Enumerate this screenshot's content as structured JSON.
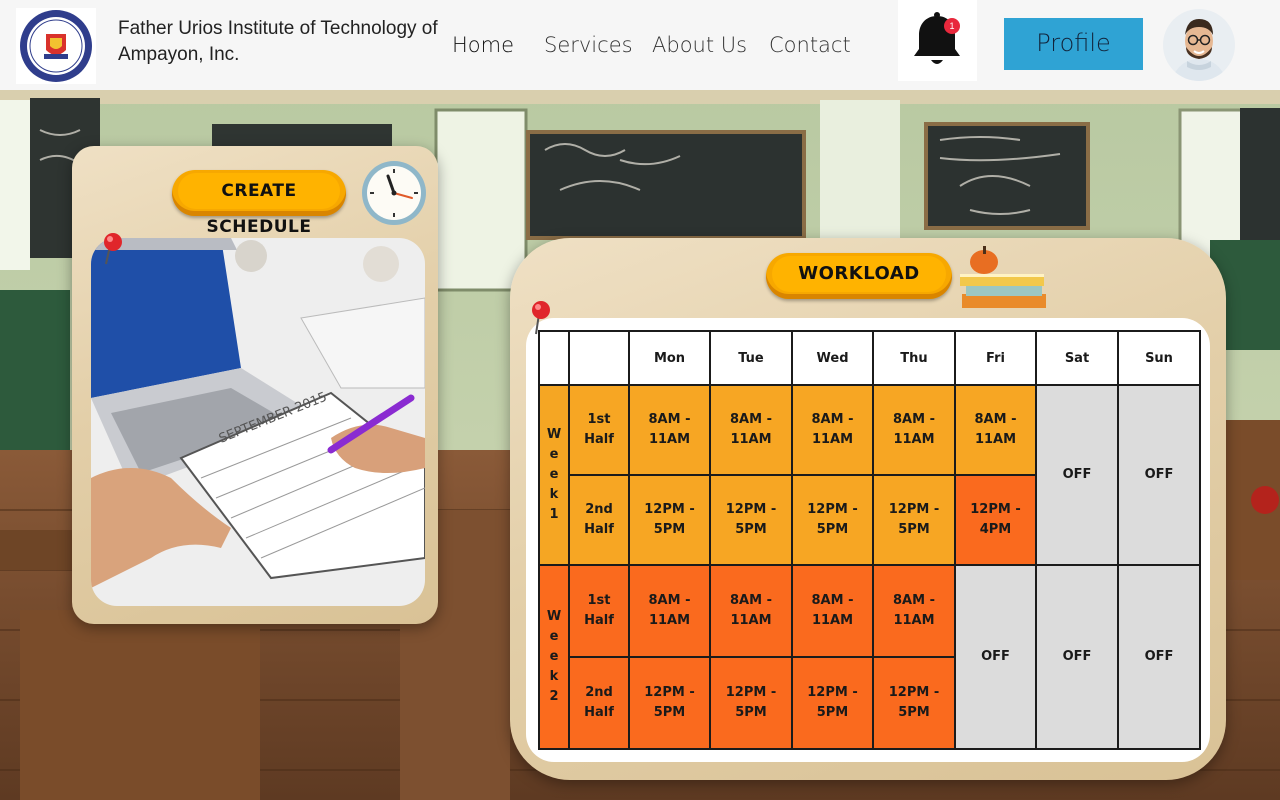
{
  "header": {
    "school_name": "Father Urios Institute of Technology of Ampayon, Inc.",
    "nav": [
      "Home",
      "Services",
      "About Us",
      "Contact"
    ],
    "notification_count": "1",
    "profile_label": "Profile"
  },
  "schedule_card": {
    "button_label": "CREATE SCHEDULE",
    "calendar_month": "SEPTEMBER 2015"
  },
  "workload_card": {
    "button_label": "WORKLOAD",
    "days": [
      "Mon",
      "Tue",
      "Wed",
      "Thu",
      "Fri",
      "Sat",
      "Sun"
    ],
    "weeks": [
      {
        "label": "Week 1",
        "letters": [
          "W",
          "e",
          "e",
          "k",
          "1"
        ],
        "halves": [
          {
            "label": [
              "1st",
              "Half"
            ],
            "slots": [
              [
                "8AM -",
                "11AM"
              ],
              [
                "8AM -",
                "11AM"
              ],
              [
                "8AM -",
                "11AM"
              ],
              [
                "8AM -",
                "11AM"
              ],
              [
                "8AM -",
                "11AM"
              ]
            ]
          },
          {
            "label": [
              "2nd",
              "Half"
            ],
            "slots": [
              [
                "12PM -",
                "5PM"
              ],
              [
                "12PM -",
                "5PM"
              ],
              [
                "12PM -",
                "5PM"
              ],
              [
                "12PM -",
                "5PM"
              ],
              [
                "12PM -",
                "4PM"
              ]
            ]
          }
        ],
        "off_days": [
          "OFF",
          "OFF"
        ]
      },
      {
        "label": "Week 2",
        "letters": [
          "W",
          "e",
          "e",
          "k",
          "2"
        ],
        "halves": [
          {
            "label": [
              "1st",
              "Half"
            ],
            "slots": [
              [
                "8AM -",
                "11AM"
              ],
              [
                "8AM -",
                "11AM"
              ],
              [
                "8AM -",
                "11AM"
              ],
              [
                "8AM -",
                "11AM"
              ]
            ]
          },
          {
            "label": [
              "2nd",
              "Half"
            ],
            "slots": [
              [
                "12PM -",
                "5PM"
              ],
              [
                "12PM -",
                "5PM"
              ],
              [
                "12PM -",
                "5PM"
              ],
              [
                "12PM -",
                "5PM"
              ]
            ]
          }
        ],
        "off_days": [
          "OFF",
          "OFF",
          "OFF"
        ]
      }
    ]
  }
}
